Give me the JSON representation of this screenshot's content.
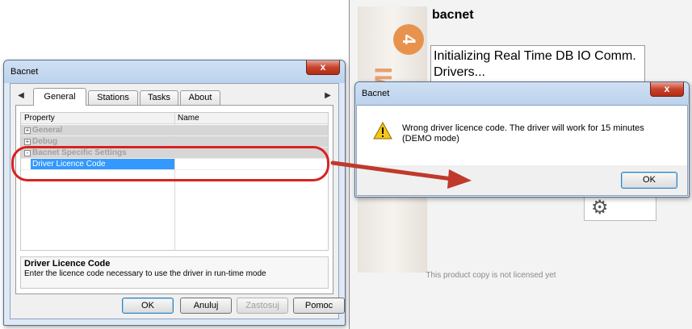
{
  "splash": {
    "logo_text": "HMI",
    "logo_number": "4",
    "title": "bacnet",
    "status": "Initializing Real Time DB IO Comm. Drivers...",
    "license_note": "This product copy is not licensed yet"
  },
  "settings_dialog": {
    "title": "Bacnet",
    "close_glyph": "x",
    "tabs": [
      {
        "label": "General"
      },
      {
        "label": "Stations"
      },
      {
        "label": "Tasks"
      },
      {
        "label": "About"
      }
    ],
    "active_tab": "General",
    "grid": {
      "columns": [
        "Property",
        "Name"
      ],
      "rows": [
        {
          "label": "General",
          "expander": "+"
        },
        {
          "label": "Debug",
          "expander": "+"
        },
        {
          "label": "Bacnet Specific Settings",
          "expander": "-"
        },
        {
          "label": "Driver Licence Code",
          "selected": true,
          "value": ""
        }
      ]
    },
    "description": {
      "title": "Driver Licence Code",
      "text": "Enter the licence code necessary to use the driver in run-time mode"
    },
    "buttons": {
      "ok": "OK",
      "cancel": "Anuluj",
      "apply": "Zastosuj",
      "help": "Pomoc"
    }
  },
  "error_dialog": {
    "title": "Bacnet",
    "close_glyph": "x",
    "icon": "warning-icon",
    "message": "Wrong driver licence code. The driver will work for 15 minutes (DEMO mode)",
    "ok": "OK"
  },
  "colors": {
    "highlight": "#d92121",
    "arrow": "#c0392b",
    "selection": "#3399ff",
    "logo_accent": "#e8934d"
  }
}
